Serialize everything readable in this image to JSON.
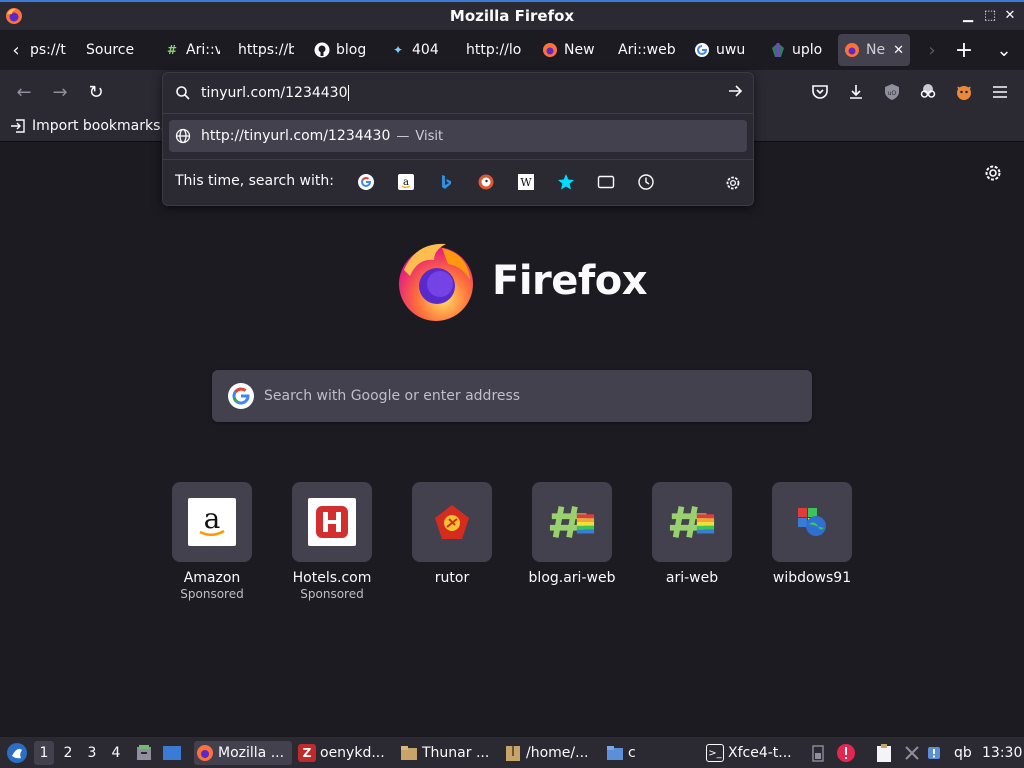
{
  "window": {
    "title": "Mozilla Firefox",
    "controls": {
      "minimize": "▁",
      "maximize": "⬚",
      "close": "✕"
    }
  },
  "tabs": [
    {
      "title": "ps://t",
      "favicon": "none"
    },
    {
      "title": "Source",
      "favicon": "none"
    },
    {
      "title": "Ari::v",
      "favicon": "hash-icon"
    },
    {
      "title": "https://b",
      "favicon": "none"
    },
    {
      "title": "blog",
      "favicon": "github-icon"
    },
    {
      "title": "404",
      "favicon": "sparkle-icon"
    },
    {
      "title": "http://lo",
      "favicon": "none"
    },
    {
      "title": "New",
      "favicon": "firefox-icon"
    },
    {
      "title": "Ari::web",
      "favicon": "none"
    },
    {
      "title": "uwu",
      "favicon": "google-icon"
    },
    {
      "title": "uplo",
      "favicon": "upload-icon"
    },
    {
      "title": "Ne",
      "favicon": "firefox-icon",
      "active": true
    }
  ],
  "tab_buttons": {
    "scroll_left": "‹",
    "scroll_right": "›",
    "new_tab": "+",
    "list_all": "⌄",
    "close_active": "✕"
  },
  "nav": {
    "back": "←",
    "forward": "→",
    "reload": "↻"
  },
  "bookmarks": {
    "import_label": "Import bookmarks..."
  },
  "urlbar": {
    "value": "tinyurl.com/1234430",
    "suggestion_url": "http://tinyurl.com/1234430",
    "suggestion_sep": "—",
    "suggestion_action": "Visit",
    "search_with_label": "This time, search with:",
    "engines": [
      "google",
      "amazon",
      "bing",
      "duckduckgo",
      "wikipedia",
      "bookmarks",
      "tabs",
      "history"
    ]
  },
  "toolbar_icons": [
    "pocket-icon",
    "download-icon",
    "ublock-icon",
    "glasses-icon",
    "tiger-icon",
    "menu-icon"
  ],
  "newtab": {
    "wordmark": "Firefox",
    "search_placeholder": "Search with Google or enter address",
    "top_sites": [
      {
        "name": "Amazon",
        "sponsored": "Sponsored",
        "icon": "amazon-icon"
      },
      {
        "name": "Hotels.com",
        "sponsored": "Sponsored",
        "icon": "hotels-icon"
      },
      {
        "name": "rutor",
        "sponsored": "",
        "icon": "rutor-icon"
      },
      {
        "name": "blog.ari-web",
        "sponsored": "",
        "icon": "hash-icon"
      },
      {
        "name": "ari-web",
        "sponsored": "",
        "icon": "hash-icon"
      },
      {
        "name": "wibdows91",
        "sponsored": "",
        "icon": "windows-globe-icon"
      }
    ]
  },
  "taskbar": {
    "workspaces": [
      "1",
      "2",
      "3",
      "4"
    ],
    "tasks": [
      {
        "label": "Mozilla ...",
        "icon": "firefox-icon"
      },
      {
        "label": "oenykd...",
        "icon": "filezilla-icon"
      },
      {
        "label": "Thunar ...",
        "icon": "thunar-icon"
      },
      {
        "label": "/home/...",
        "icon": "archive-icon"
      },
      {
        "label": "c",
        "icon": "folder-icon"
      },
      {
        "label": "Xfce4-t...",
        "icon": "terminal-icon"
      }
    ],
    "clock": "13:30",
    "tray_text": "qb"
  },
  "colors": {
    "bg": "#1c1b22",
    "chrome": "#2b2a33",
    "tile": "#42414d",
    "accent": "#3a7bd5"
  }
}
